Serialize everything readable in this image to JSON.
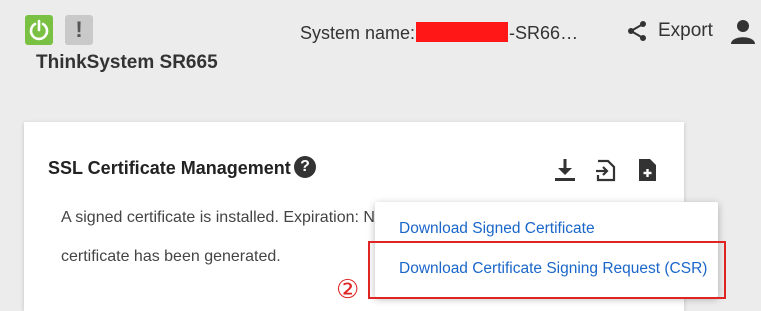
{
  "header": {
    "alert_symbol": "!",
    "product_title": "ThinkSystem SR665",
    "system_name_prefix": "System name:",
    "system_name_suffix": "-SR66…",
    "export_label": "Export"
  },
  "card": {
    "title": "SSL Certificate Management",
    "help_symbol": "?",
    "text_line1": "A signed certificate is installed. Expiration: N",
    "text_line2": "certificate has been generated.",
    "icons": [
      "download-icon",
      "import-icon",
      "add-file-icon"
    ]
  },
  "dropdown": {
    "items": [
      {
        "label": "Download Signed Certificate"
      },
      {
        "label": "Download Certificate Signing Request (CSR)"
      }
    ]
  },
  "annotation": {
    "step_marker": "②",
    "highlight_color": "#e02424"
  },
  "colors": {
    "power_green": "#7ac143",
    "link_blue": "#1a66c9",
    "redaction": "#ff1616"
  }
}
